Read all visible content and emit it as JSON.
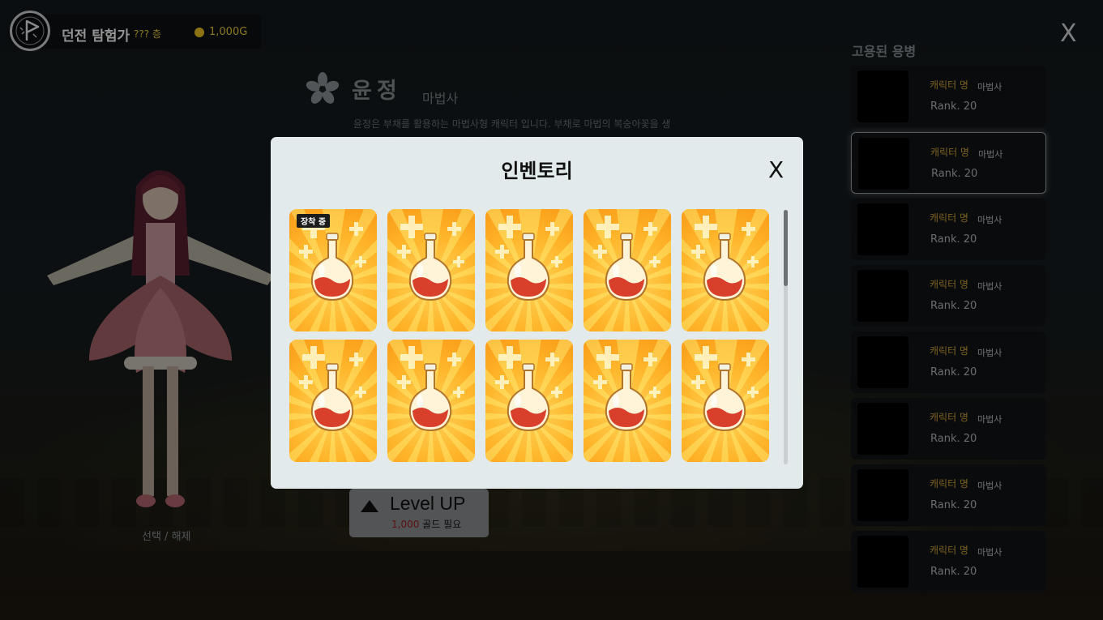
{
  "header": {
    "game_title": "던전 탐험가",
    "floor": "??? 층",
    "gold": "1,000G",
    "close_label": "X",
    "emblem_icon": "dungeon-flag-icon"
  },
  "character": {
    "name": "윤정",
    "class": "마법사",
    "description": "윤정은 부채를 활용하는 마법사형 캐릭터 입니다. 부채로 마법의 복숭아꽃을 생성하는 것을 주력합니다. 상태적으로 적은 HP와 많은 MP로 마지도 합니다.",
    "icon": "blossom-icon",
    "select_toggle": "선택 / 해제"
  },
  "level_up": {
    "label": "Level UP",
    "cost_amount": "1,000",
    "cost_suffix": " 골드 필요"
  },
  "mercenaries": {
    "title": "고용된 용병",
    "items": [
      {
        "name": "캐릭터 명",
        "class": "마법사",
        "rank": "Rank. 20",
        "selected": false
      },
      {
        "name": "캐릭터 명",
        "class": "마법사",
        "rank": "Rank. 20",
        "selected": true
      },
      {
        "name": "캐릭터 명",
        "class": "마법사",
        "rank": "Rank. 20",
        "selected": false
      },
      {
        "name": "캐릭터 명",
        "class": "마법사",
        "rank": "Rank. 20",
        "selected": false
      },
      {
        "name": "캐릭터 명",
        "class": "마법사",
        "rank": "Rank. 20",
        "selected": false
      },
      {
        "name": "캐릭터 명",
        "class": "마법사",
        "rank": "Rank. 20",
        "selected": false
      },
      {
        "name": "캐릭터 명",
        "class": "마법사",
        "rank": "Rank. 20",
        "selected": false
      },
      {
        "name": "캐릭터 명",
        "class": "마법사",
        "rank": "Rank. 20",
        "selected": false
      }
    ]
  },
  "inventory": {
    "title": "인벤토리",
    "close_label": "X",
    "equipped_badge": "장착 중",
    "items": [
      {
        "icon": "health-potion-icon",
        "equipped": true
      },
      {
        "icon": "health-potion-icon",
        "equipped": false
      },
      {
        "icon": "health-potion-icon",
        "equipped": false
      },
      {
        "icon": "health-potion-icon",
        "equipped": false
      },
      {
        "icon": "health-potion-icon",
        "equipped": false
      },
      {
        "icon": "health-potion-icon",
        "equipped": false
      },
      {
        "icon": "health-potion-icon",
        "equipped": false
      },
      {
        "icon": "health-potion-icon",
        "equipped": false
      },
      {
        "icon": "health-potion-icon",
        "equipped": false
      },
      {
        "icon": "health-potion-icon",
        "equipped": false
      }
    ],
    "scroll_fraction": 0.3
  },
  "colors": {
    "gold_text": "#f3d23b",
    "merc_name": "#d8a83a",
    "cost_number": "#a01c1c",
    "modal_bg": "#e3eaec",
    "potion_card": "#ffb52a"
  }
}
